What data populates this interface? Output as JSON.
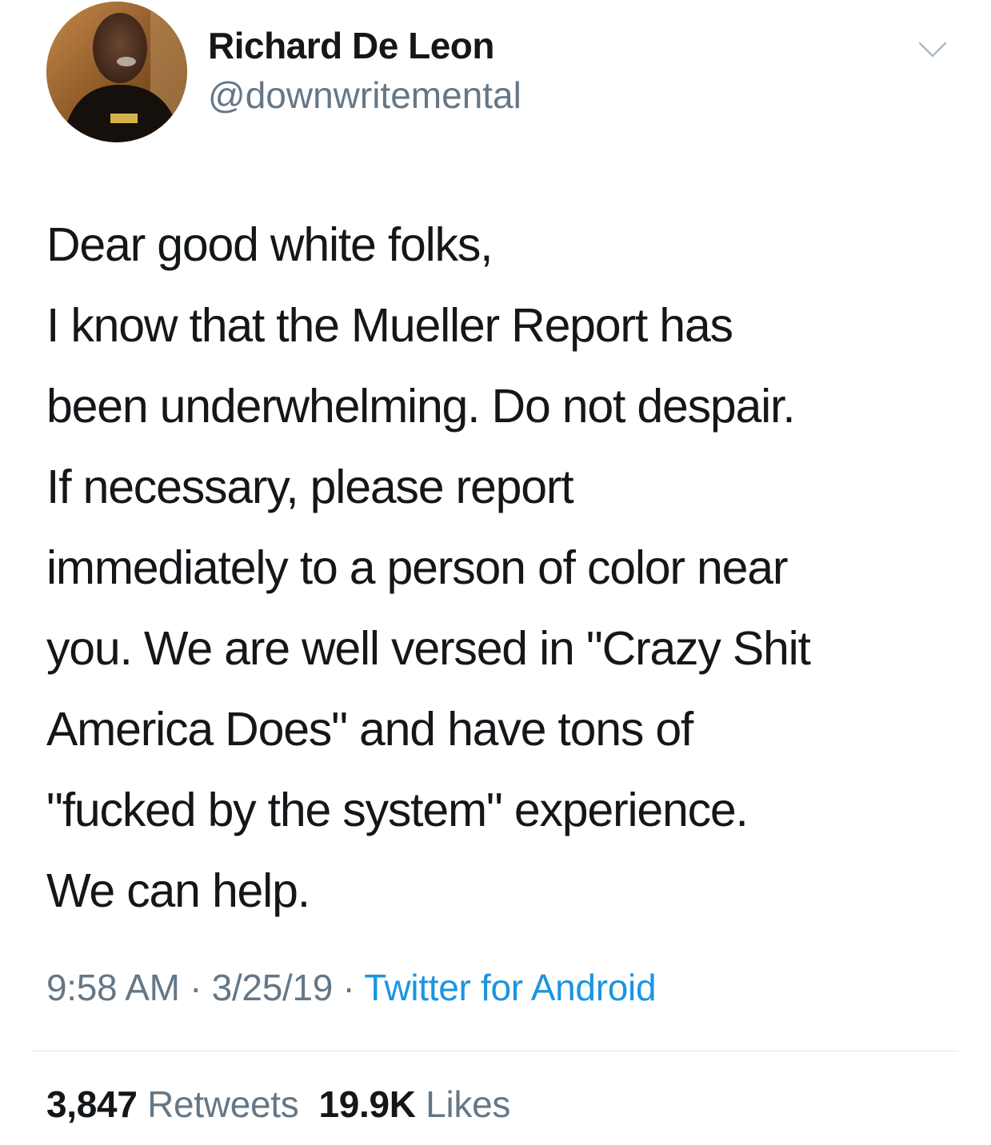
{
  "author": {
    "name": "Richard De Leon",
    "handle": "@downwritemental"
  },
  "tweet": {
    "lines": [
      "Dear good white folks,",
      "I know that the Mueller Report has",
      "been underwhelming. Do not despair.",
      "If necessary, please report",
      "immediately to a person of color near",
      "you. We are well versed in \"Crazy Shit",
      "America Does\" and have tons of",
      "\"fucked by the system\" experience.",
      "We can help."
    ],
    "time": "9:58 AM",
    "date": "3/25/19",
    "separator": " · ",
    "source": "Twitter for Android"
  },
  "stats": {
    "retweets_count": "3,847",
    "retweets_label": "Retweets",
    "likes_count": "19.9K",
    "likes_label": "Likes"
  },
  "icons": {
    "menu": "chevron-down-icon",
    "avatar": "profile-photo"
  },
  "colors": {
    "text": "#14171a",
    "secondary": "#657786",
    "link": "#1b95e0",
    "divider": "#e1e8ed"
  }
}
